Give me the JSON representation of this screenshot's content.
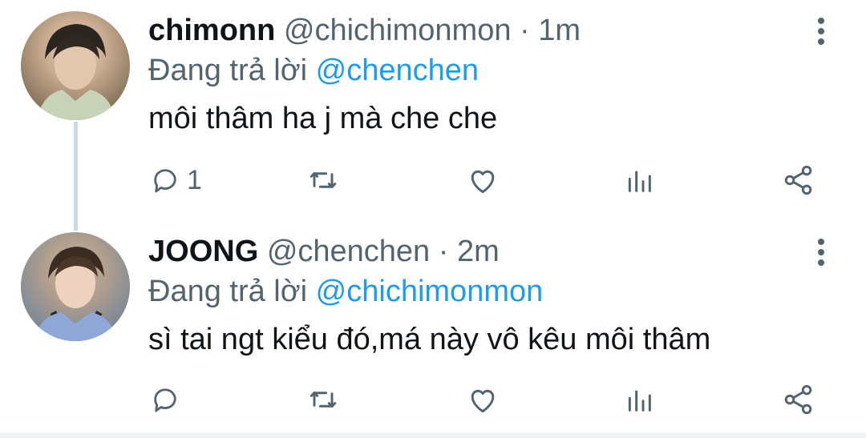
{
  "tweets": [
    {
      "display_name": "chimonn",
      "handle": "@chichimonmon",
      "separator": "·",
      "time": "1m",
      "replying_prefix": "Đang trả lời",
      "replying_to": "@chenchen",
      "text": "môi thâm ha j mà che che",
      "reply_count": "1"
    },
    {
      "display_name": "JOONG",
      "handle": "@chenchen",
      "separator": "·",
      "time": "2m",
      "replying_prefix": "Đang trả lời",
      "replying_to": "@chichimonmon",
      "text": "sì tai ngt kiểu đó,má này vô kêu môi thâm",
      "reply_count": ""
    }
  ],
  "icons": {
    "reply": "reply-icon",
    "retweet": "retweet-icon",
    "like": "like-icon",
    "analytics": "analytics-icon",
    "share": "share-icon",
    "more": "more-vertical-icon"
  },
  "colors": {
    "name": "#0f1419",
    "secondary": "#536471",
    "mention": "#1d9bf0",
    "thread_line": "#cfd9de"
  }
}
